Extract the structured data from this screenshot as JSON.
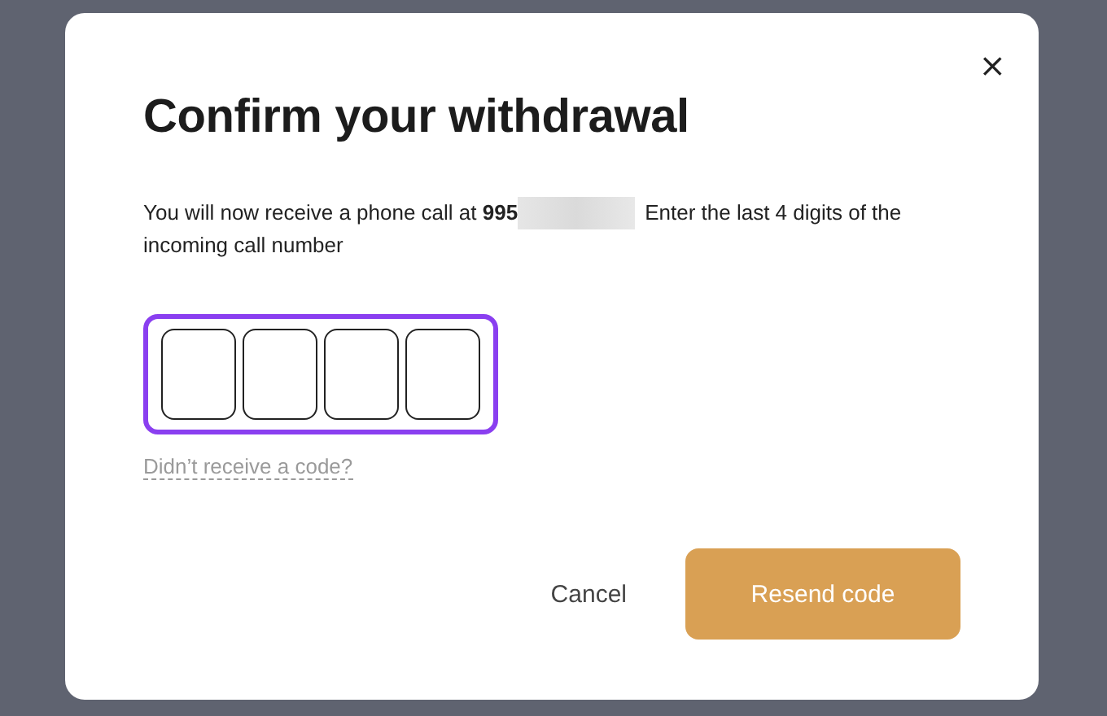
{
  "dialog": {
    "title": "Confirm your withdrawal",
    "close": "×",
    "message": {
      "before": "You will now receive a phone call at **995**",
      "redacted": true,
      "after": "Enter the last 4 digits of the incoming call number"
    },
    "code_field": {
      "focused": true,
      "cells": [
        {
          "filled": false
        },
        {
          "filled": false
        },
        {
          "filled": false
        },
        {
          "filled": false
        }
      ]
    },
    "help_link": "Didn’t receive a code?",
    "buttons": [
      {
        "label": "Cancel",
        "kind": "text"
      },
      {
        "label": "Resend code",
        "kind": "primary"
      }
    ]
  }
}
